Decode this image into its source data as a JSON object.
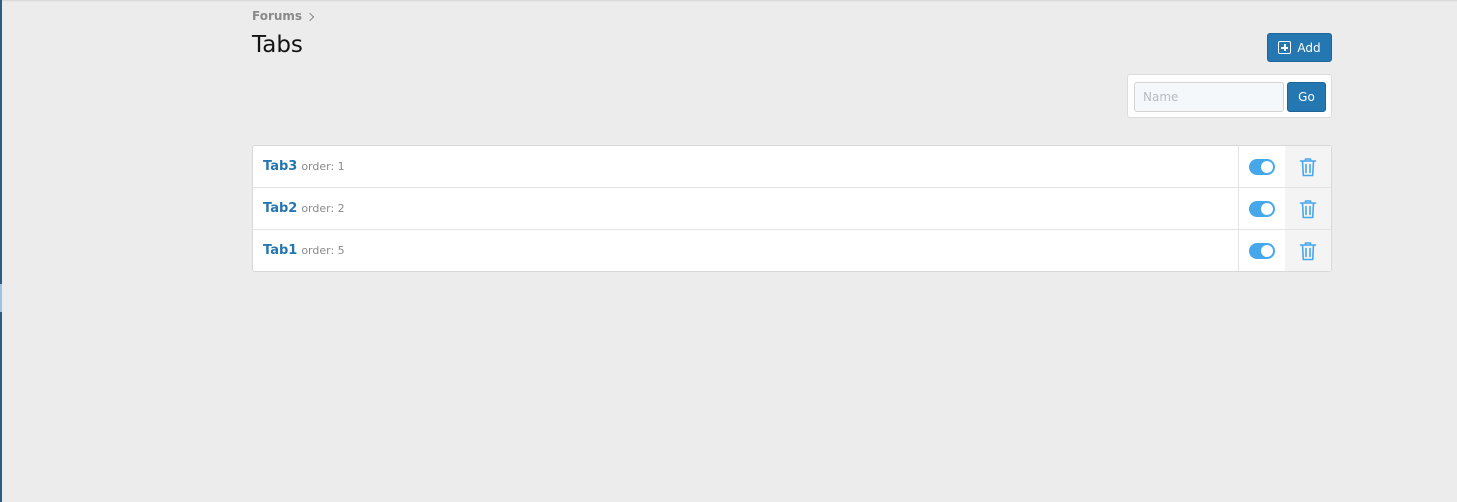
{
  "breadcrumb": {
    "items": [
      "Forums"
    ]
  },
  "page": {
    "title": "Tabs"
  },
  "toolbar": {
    "add_label": "Add",
    "add_icon": "plus-square-icon"
  },
  "filter": {
    "placeholder": "Name",
    "value": "",
    "go_label": "Go"
  },
  "tabs": [
    {
      "name": "Tab3",
      "order_text": "order: 1",
      "enabled": true
    },
    {
      "name": "Tab2",
      "order_text": "order: 2",
      "enabled": true
    },
    {
      "name": "Tab1",
      "order_text": "order: 5",
      "enabled": true
    }
  ],
  "colors": {
    "accent": "#2577b1",
    "toggle_on": "#47a7eb",
    "background": "#ececec"
  }
}
